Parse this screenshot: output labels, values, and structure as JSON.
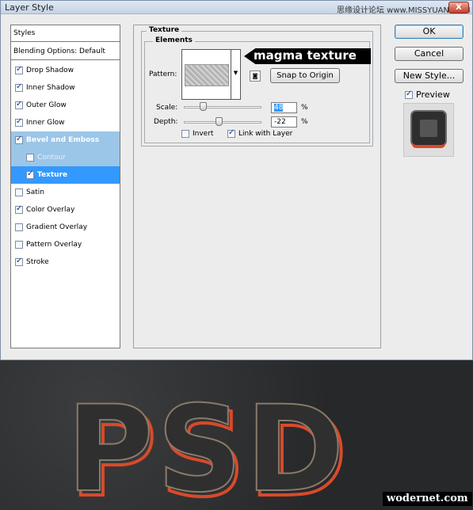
{
  "window": {
    "title": "Layer Style",
    "watermark": "思缘设计论坛 www.MISSYUAN.COM",
    "close_label": "X"
  },
  "styles_panel": {
    "header": "Styles",
    "blending": "Blending Options: Default",
    "items": [
      {
        "label": "Drop Shadow",
        "checked": true
      },
      {
        "label": "Inner Shadow",
        "checked": true
      },
      {
        "label": "Outer Glow",
        "checked": true
      },
      {
        "label": "Inner Glow",
        "checked": true
      },
      {
        "label": "Bevel and Emboss",
        "checked": true,
        "state": "selected-parent"
      },
      {
        "label": "Contour",
        "checked": false,
        "state": "sub"
      },
      {
        "label": "Texture",
        "checked": true,
        "state": "selected"
      },
      {
        "label": "Satin",
        "checked": false
      },
      {
        "label": "Color Overlay",
        "checked": true
      },
      {
        "label": "Gradient Overlay",
        "checked": false
      },
      {
        "label": "Pattern Overlay",
        "checked": false
      },
      {
        "label": "Stroke",
        "checked": true
      }
    ]
  },
  "texture": {
    "section_title": "Texture",
    "group_title": "Elements",
    "pattern_label": "Pattern:",
    "snap_button": "Snap to Origin",
    "callout": "magma texture",
    "scale_label": "Scale:",
    "scale_value": "48",
    "scale_unit": "%",
    "scale_slider_fraction": 0.24,
    "depth_label": "Depth:",
    "depth_value": "-22",
    "depth_unit": "%",
    "depth_slider_fraction": 0.45,
    "invert_label": "Invert",
    "invert_checked": false,
    "link_label": "Link with Layer",
    "link_checked": true
  },
  "buttons": {
    "ok": "OK",
    "cancel": "Cancel",
    "new_style": "New Style...",
    "preview_label": "Preview",
    "preview_checked": true
  },
  "canvas": {
    "text": "PSD",
    "fill_color": "#2f2f2f",
    "stroke_color": "#d84a2a",
    "credit": "wodernet.com"
  }
}
